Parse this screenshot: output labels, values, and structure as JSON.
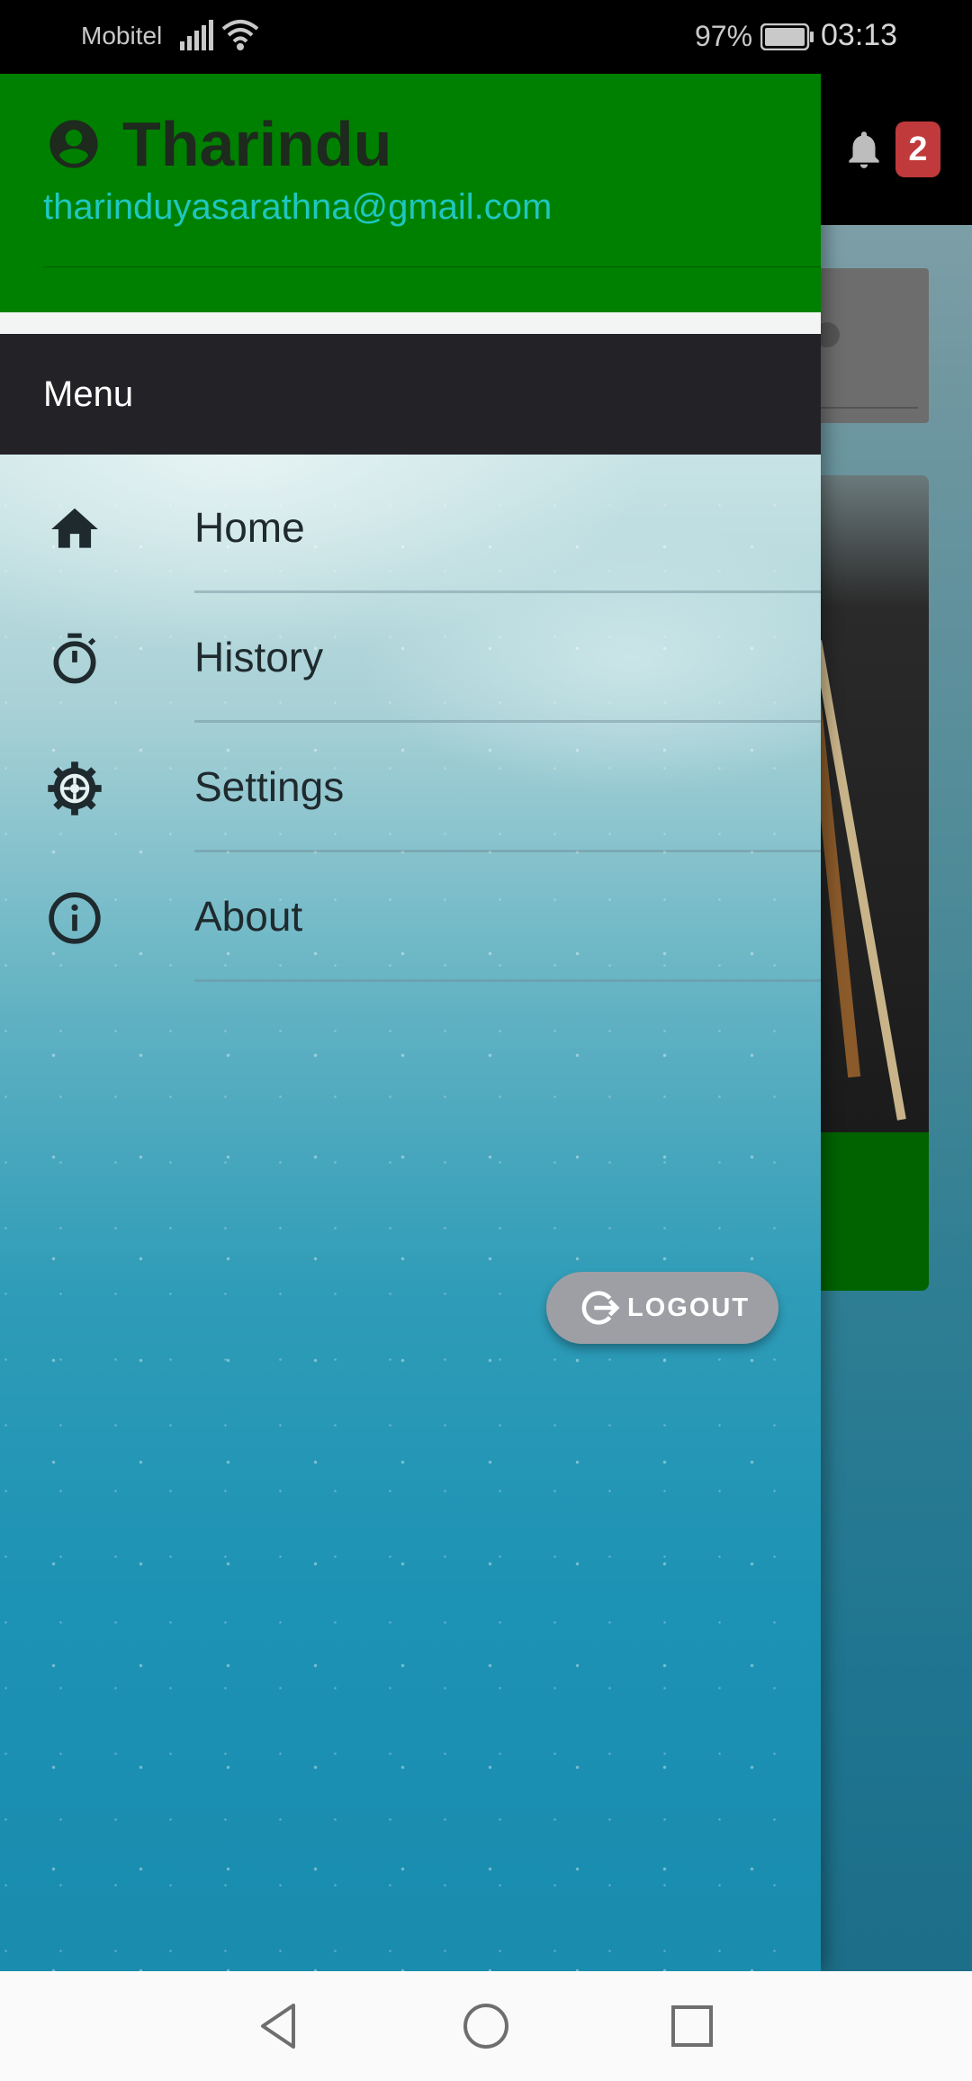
{
  "status_bar": {
    "carrier": "Mobitel",
    "battery_percent": "97%",
    "time": "03:13"
  },
  "app_bar": {
    "notification_count": "2"
  },
  "drawer": {
    "user_name": "Tharindu",
    "user_email": "tharinduyasarathna@gmail.com",
    "menu_title": "Menu",
    "items": [
      {
        "label": "Home",
        "icon": "home-icon"
      },
      {
        "label": "History",
        "icon": "timer-icon"
      },
      {
        "label": "Settings",
        "icon": "settings-icon"
      },
      {
        "label": "About",
        "icon": "info-icon"
      }
    ],
    "logout_label": "LOGOUT"
  },
  "colors": {
    "header_green": "#008000",
    "email_teal": "#1ec7c0",
    "menu_bar_dark": "#232327",
    "badge_red": "#c0393b",
    "logout_grey": "#9e9fa5"
  }
}
